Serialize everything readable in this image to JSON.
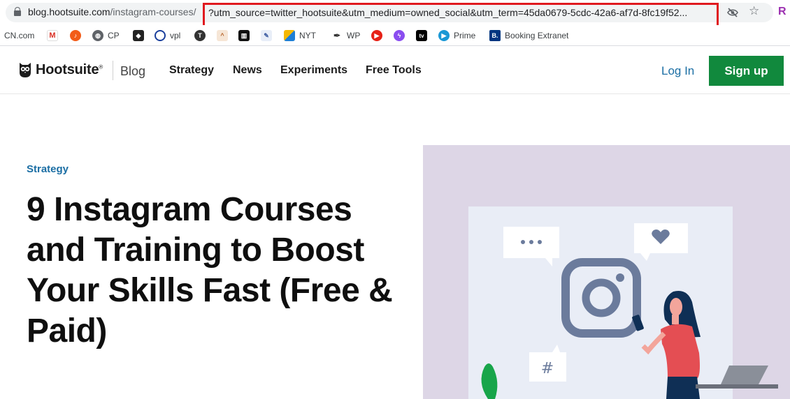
{
  "browser": {
    "url_host": "blog.hootsuite.com",
    "url_path": "/instagram-courses/",
    "url_query": "?utm_source=twitter_hootsuite&utm_medium=owned_social&utm_term=45da0679-5cdc-42a6-af7d-8fc19f52...",
    "extension_letter": "R",
    "highlight_color": "#e0191f"
  },
  "bookmarks": [
    {
      "label": "CN.com",
      "icon": "cn-icon"
    },
    {
      "label": "",
      "icon": "gmail-icon"
    },
    {
      "label": "",
      "icon": "music-icon"
    },
    {
      "label": "CP",
      "icon": "globe-icon"
    },
    {
      "label": "",
      "icon": "shield-icon"
    },
    {
      "label": "vpl",
      "icon": "vpl-icon"
    },
    {
      "label": "",
      "icon": "t-icon"
    },
    {
      "label": "",
      "icon": "hat-icon"
    },
    {
      "label": "",
      "icon": "book-icon"
    },
    {
      "label": "",
      "icon": "note-icon"
    },
    {
      "label": "NYT",
      "icon": "cube-icon"
    },
    {
      "label": "WP",
      "icon": "pen-icon"
    },
    {
      "label": "",
      "icon": "youtube-icon"
    },
    {
      "label": "",
      "icon": "messenger-icon"
    },
    {
      "label": "",
      "icon": "appletv-icon"
    },
    {
      "label": "Prime",
      "icon": "prime-icon"
    },
    {
      "label": "Booking Extranet",
      "icon": "booking-icon"
    }
  ],
  "site": {
    "brand": "Hootsuite",
    "brand_mark": "®",
    "section": "Blog",
    "nav": [
      "Strategy",
      "News",
      "Experiments",
      "Free Tools"
    ],
    "login": "Log In",
    "signup": "Sign up",
    "brand_green": "#11893d",
    "link_blue": "#1b6ea4"
  },
  "article": {
    "category": "Strategy",
    "headline": "9 Instagram Courses and Training to Boost Your Skills Fast (Free & Paid)"
  },
  "illustration": {
    "icon": "instagram-logo-icon",
    "hashtag": "#",
    "speech_bubble_dots": "•••"
  }
}
